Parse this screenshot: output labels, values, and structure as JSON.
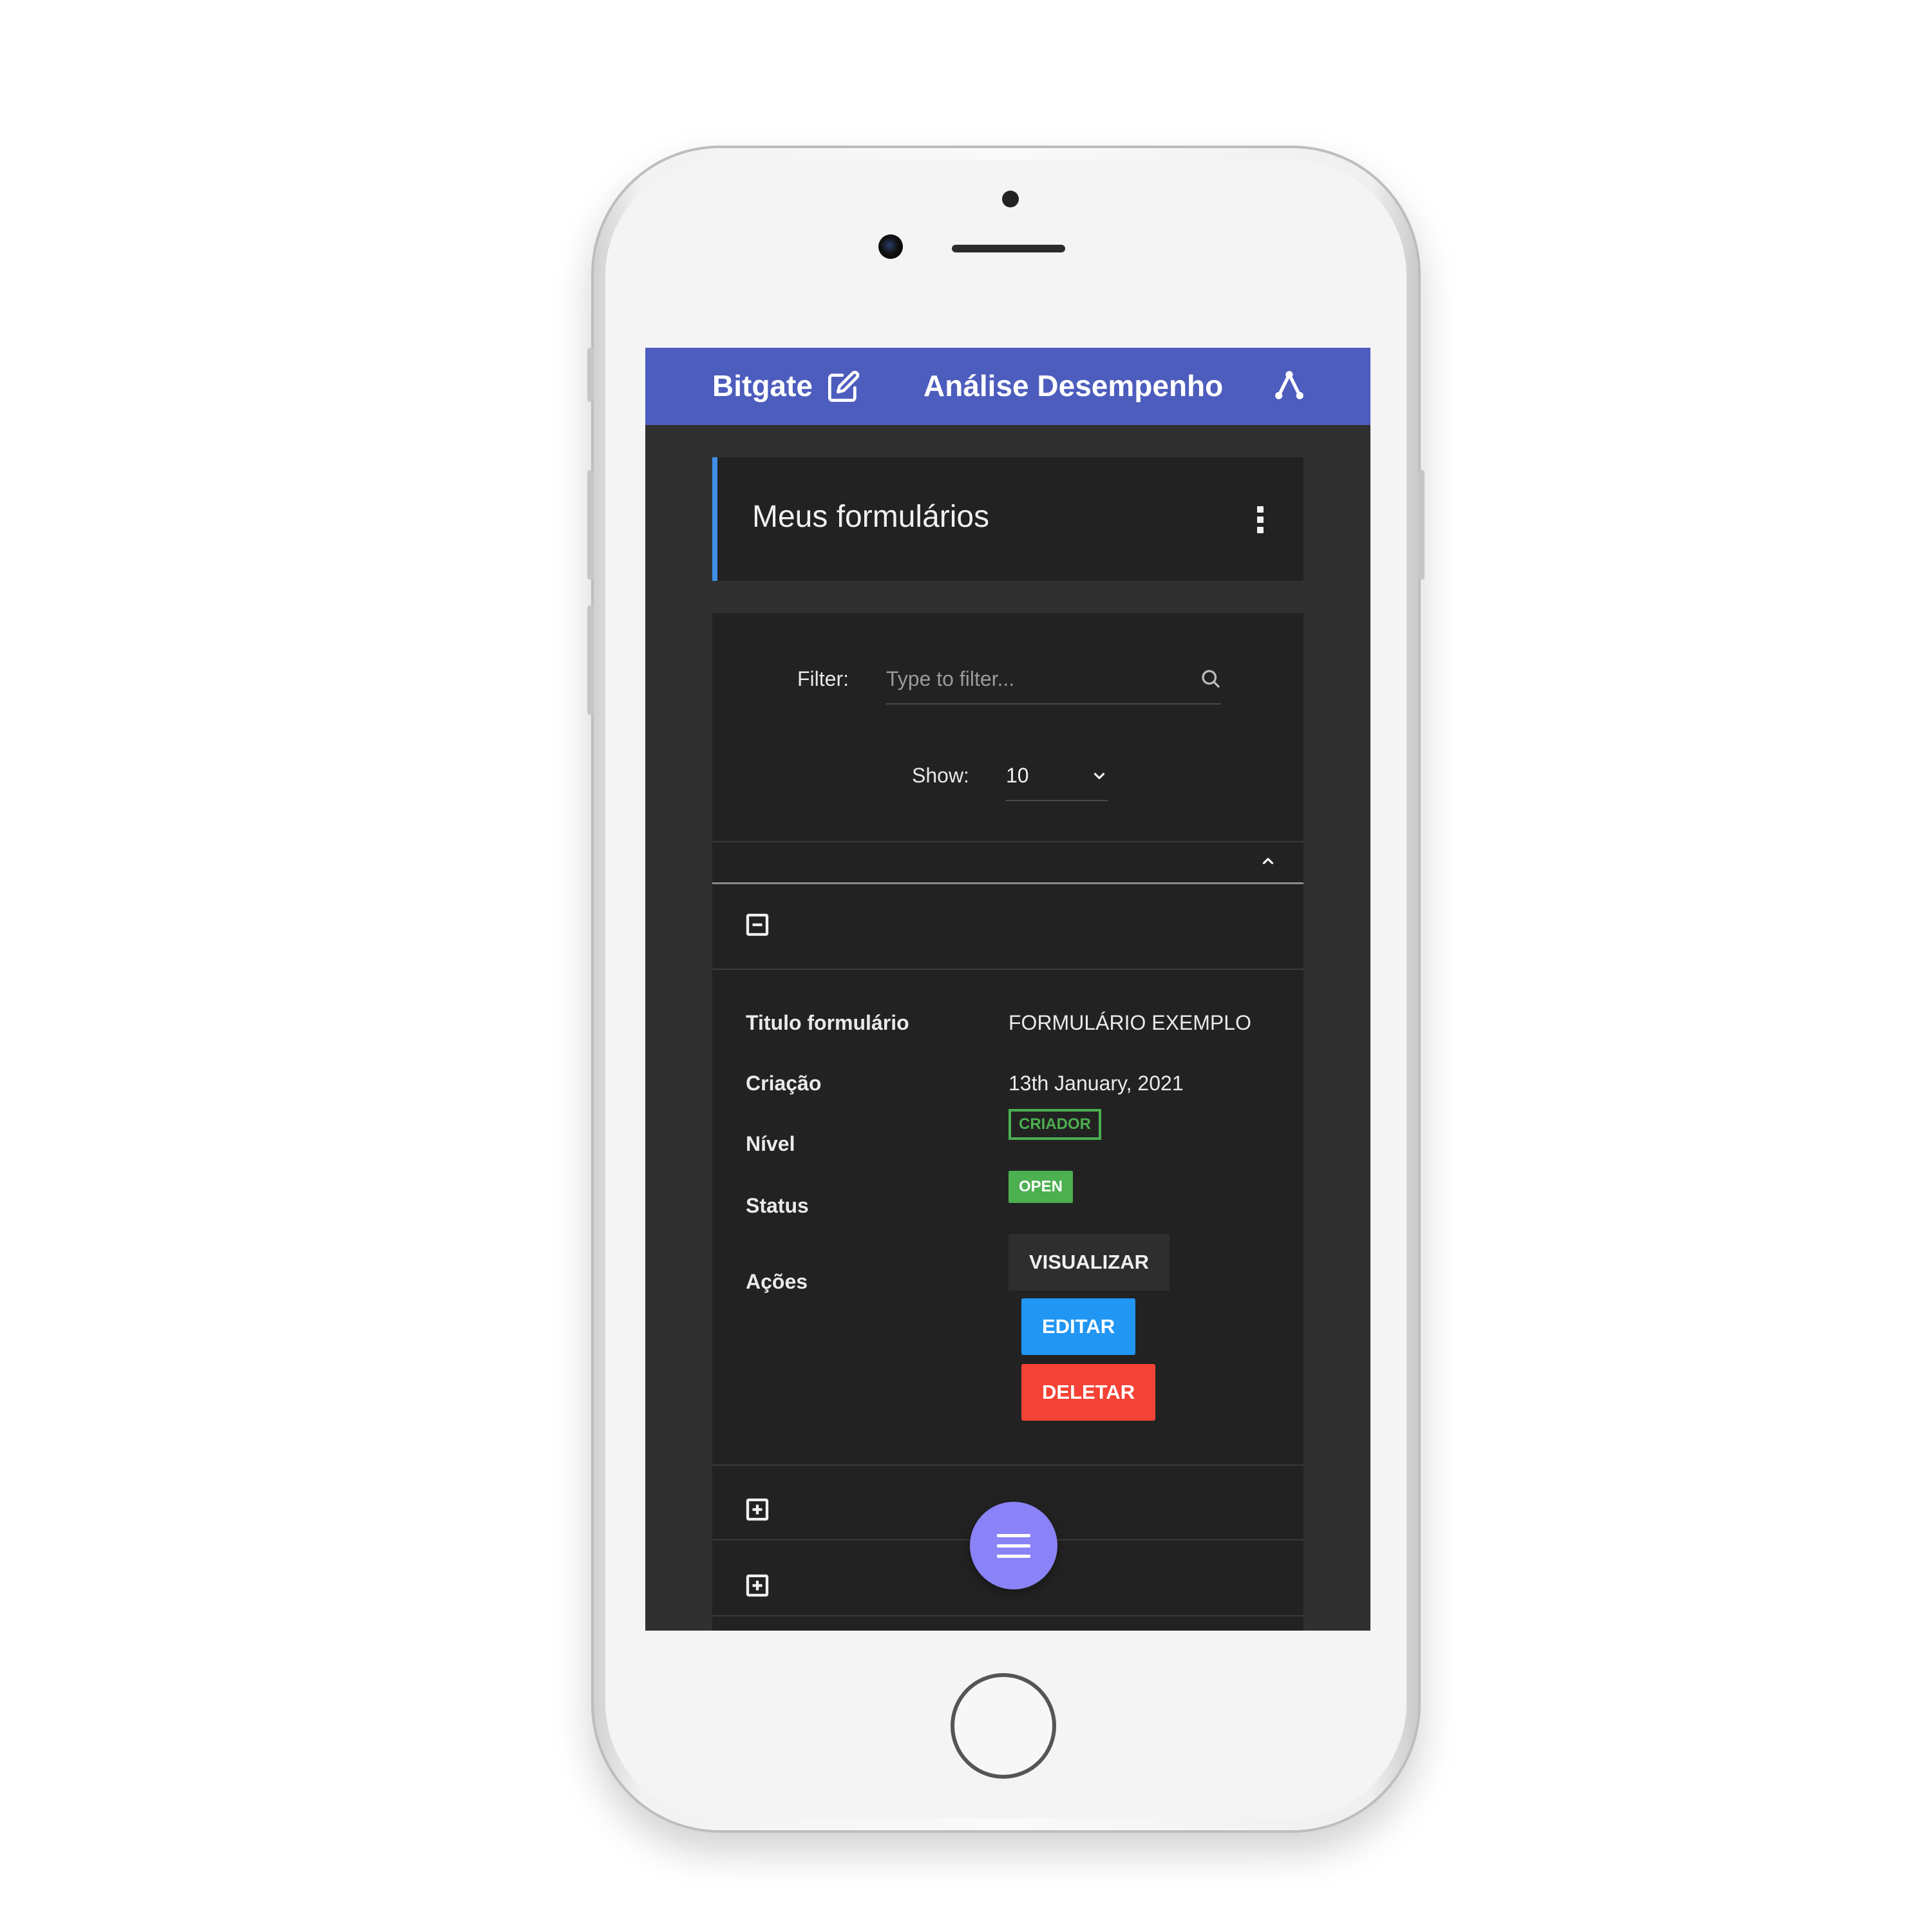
{
  "appbar": {
    "brand": "Bitgate",
    "title": "Análise Desempenho",
    "brand_icon": "edit-icon",
    "right_icon": "tree-icon",
    "color": "#4d5dbd"
  },
  "page": {
    "title": "Meus formulários",
    "menu_icon": "kebab-menu-icon"
  },
  "filter": {
    "label": "Filter:",
    "placeholder": "Type to filter...",
    "value": ""
  },
  "show": {
    "label": "Show:",
    "value": "10"
  },
  "record": {
    "fields": [
      {
        "label": "Titulo formulário",
        "value": "FORMULÁRIO EXEMPLO"
      },
      {
        "label": "Criação",
        "value": "13th January, 2021"
      },
      {
        "label": "Nível",
        "value": "CRIADOR"
      },
      {
        "label": "Status",
        "value": "OPEN"
      },
      {
        "label": "Ações",
        "value": ""
      }
    ],
    "actions": {
      "view": "VISUALIZAR",
      "edit": "EDITAR",
      "delete": "DELETAR"
    }
  },
  "colors": {
    "accent_border": "#3f8fe6",
    "success": "#4caf50",
    "primary": "#2196f3",
    "danger": "#f44336",
    "fab": "#8a83f7"
  }
}
